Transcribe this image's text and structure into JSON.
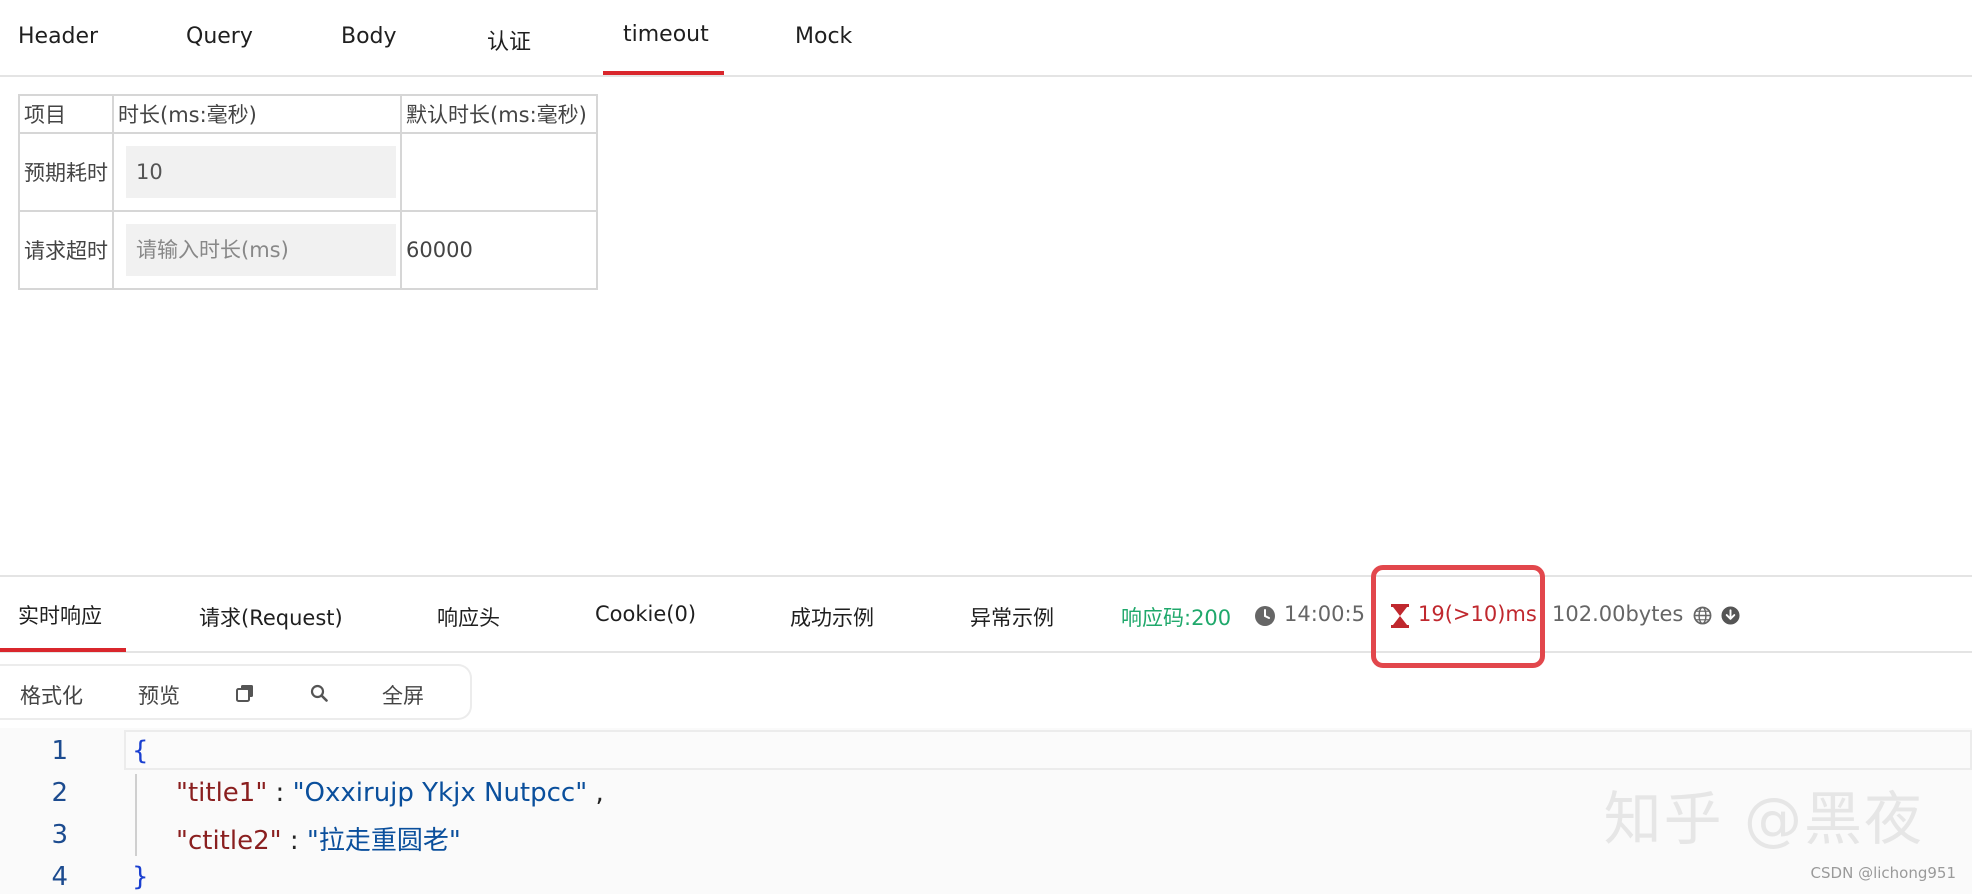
{
  "request_tabs": {
    "items": [
      {
        "label": "Header"
      },
      {
        "label": "Query"
      },
      {
        "label": "Body"
      },
      {
        "label": "认证"
      },
      {
        "label": "timeout"
      },
      {
        "label": "Mock"
      }
    ],
    "active": "timeout"
  },
  "timeout_table": {
    "headers": [
      "项目",
      "时长(ms:毫秒)",
      "默认时长(ms:毫秒)"
    ],
    "rows": [
      {
        "item": "预期耗时",
        "value": "10",
        "placeholder": "",
        "default": ""
      },
      {
        "item": "请求超时",
        "value": "",
        "placeholder": "请输入时长(ms)",
        "default": "60000"
      }
    ]
  },
  "response_tabs": {
    "items": [
      {
        "label": "实时响应"
      },
      {
        "label": "请求(Request)"
      },
      {
        "label": "响应头"
      },
      {
        "label": "Cookie(0)"
      },
      {
        "label": "成功示例"
      },
      {
        "label": "异常示例"
      }
    ],
    "active": "实时响应"
  },
  "status": {
    "code_text": "响应码:200",
    "time_text": "14:00:5",
    "duration_text": "19(>10)ms",
    "size_text": "102.00bytes",
    "colors": {
      "success": "#1fa86b",
      "warning": "#c0282e",
      "highlight_border": "#e2474c"
    }
  },
  "toolbar": {
    "format_label": "格式化",
    "preview_label": "预览",
    "fullscreen_label": "全屏"
  },
  "code": {
    "line_numbers": [
      "1",
      "2",
      "3",
      "4"
    ],
    "open_brace": "{",
    "close_brace": "}",
    "entries": [
      {
        "key": "\"title1\"",
        "value": "\"Oxxirujp Ykjx Nutpcc\"",
        "trailing": ","
      },
      {
        "key": "\"ctitle2\"",
        "value": "\"拉走重圆老\"",
        "trailing": ""
      }
    ]
  },
  "watermark": {
    "text": "知乎 @黑夜",
    "credit": "CSDN @lichong951"
  },
  "accent_color": "#d9262c"
}
